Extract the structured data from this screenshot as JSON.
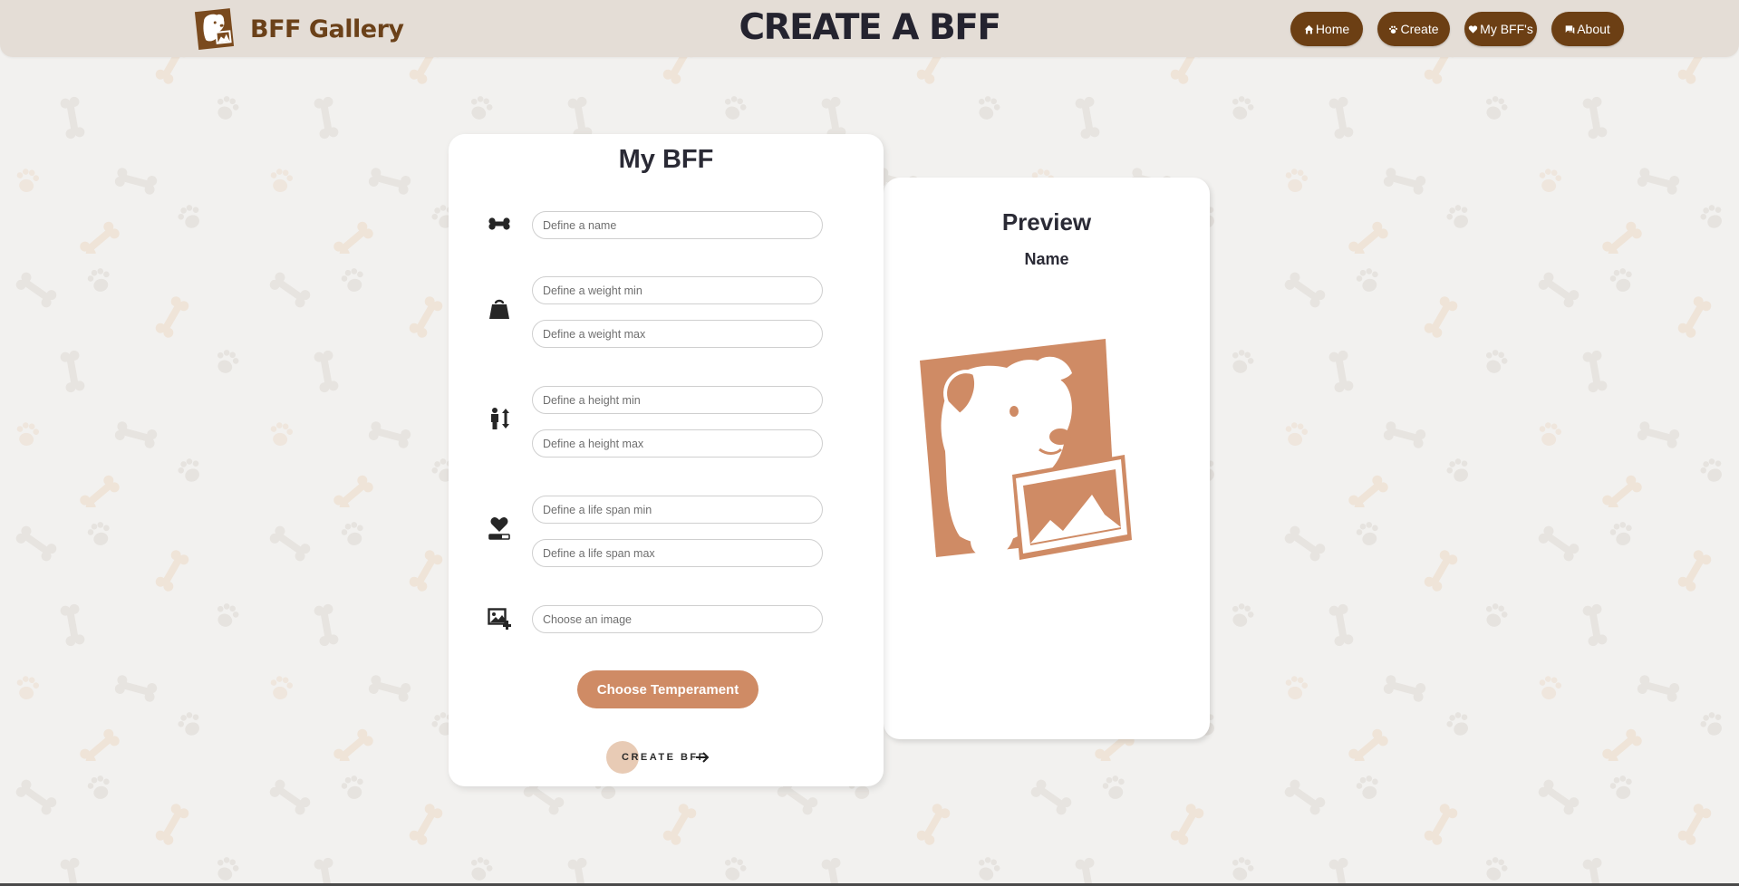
{
  "header": {
    "brand": "BFF Gallery",
    "title": "CREATE A BFF",
    "nav": [
      {
        "label": "Home",
        "icon": "home-icon"
      },
      {
        "label": "Create",
        "icon": "paw-icon"
      },
      {
        "label": "My BFF's",
        "icon": "heart-icon"
      },
      {
        "label": "About",
        "icon": "chat-icon"
      }
    ]
  },
  "form": {
    "title": "My BFF",
    "fields": {
      "name": {
        "placeholder": "Define a name",
        "icon": "bone-icon"
      },
      "weight_min": {
        "placeholder": "Define a weight min",
        "icon": "weight-icon"
      },
      "weight_max": {
        "placeholder": "Define a weight max"
      },
      "height_min": {
        "placeholder": "Define a height min",
        "icon": "height-icon"
      },
      "height_max": {
        "placeholder": "Define a height max"
      },
      "life_min": {
        "placeholder": "Define a life span min",
        "icon": "heart-bar-icon"
      },
      "life_max": {
        "placeholder": "Define a life span max"
      },
      "image": {
        "placeholder": "Choose an image",
        "icon": "add-image-icon"
      }
    },
    "temperament_label": "Choose Temperament",
    "create_label": "CREATE BFF"
  },
  "preview": {
    "title": "Preview",
    "name": "Name",
    "image": "dog-logo-image"
  },
  "colors": {
    "brand_brown": "#6c3f14",
    "accent": "#cf8b65",
    "header_bg": "#e4ddd6",
    "page_bg": "#f2f1ef"
  }
}
